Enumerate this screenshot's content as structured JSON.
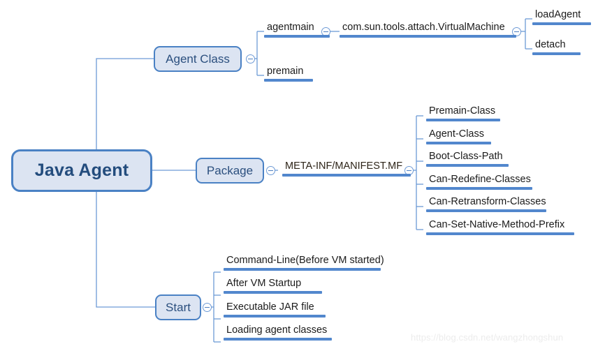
{
  "diagram": {
    "type": "mind-map",
    "root": {
      "label": "Java Agent"
    },
    "branches": [
      {
        "label": "Agent Class"
      },
      {
        "label": "Package"
      },
      {
        "label": "Start"
      }
    ],
    "agent_class": {
      "children": [
        {
          "label": "agentmain"
        },
        {
          "label": "premain"
        }
      ],
      "agentmain_child": {
        "label": "com.sun.tools.attach.VirtualMachine"
      },
      "virtualmachine_children": [
        {
          "label": "loadAgent"
        },
        {
          "label": "detach"
        }
      ]
    },
    "package": {
      "manifest": {
        "label": "META-INF/MANIFEST.MF"
      },
      "attributes": [
        {
          "label": "Premain-Class"
        },
        {
          "label": "Agent-Class"
        },
        {
          "label": "Boot-Class-Path"
        },
        {
          "label": "Can-Redefine-Classes"
        },
        {
          "label": "Can-Retransform-Classes"
        },
        {
          "label": "Can-Set-Native-Method-Prefix"
        }
      ]
    },
    "start": {
      "children": [
        {
          "label": "Command-Line(Before VM started)"
        },
        {
          "label": "After VM Startup"
        },
        {
          "label": "Executable JAR file"
        },
        {
          "label": "Loading agent classes"
        }
      ]
    }
  },
  "watermark": {
    "text": "https://blog.csdn.net/wangzhongshun"
  },
  "colors": {
    "node_fill": "#dce4f2",
    "node_border": "#4a81c4",
    "root_text": "#234c7d",
    "branch_text": "#2b4f7e",
    "underline_bar": "#5287cd",
    "wire": "#6d9ad6",
    "leaf_text": "#1b1b1b",
    "watermark": "#ececec"
  }
}
